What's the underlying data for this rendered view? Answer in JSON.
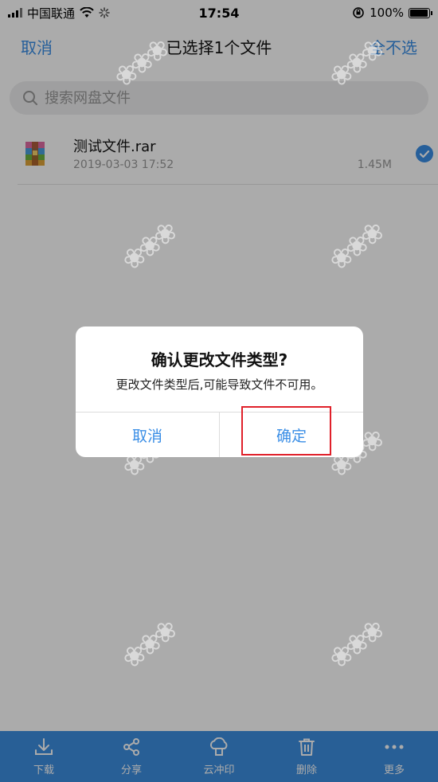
{
  "status": {
    "carrier": "中国联通",
    "time": "17:54",
    "battery": "100%",
    "battery_level": 1.0,
    "icons": [
      "signal-icon",
      "wifi-icon",
      "loading-icon",
      "orientation-lock-icon",
      "battery-icon"
    ]
  },
  "nav": {
    "cancel": "取消",
    "title": "已选择1个文件",
    "deselect_all": "全不选"
  },
  "search": {
    "placeholder": "搜索网盘文件"
  },
  "files": [
    {
      "name": "测试文件.rar",
      "date": "2019-03-03 17:52",
      "size": "1.45M",
      "selected": true,
      "icon": "rar-archive-icon"
    }
  ],
  "toolbar": {
    "items": [
      {
        "label": "下载",
        "icon": "download-icon"
      },
      {
        "label": "分享",
        "icon": "share-icon"
      },
      {
        "label": "云冲印",
        "icon": "cloud-print-icon"
      },
      {
        "label": "删除",
        "icon": "trash-icon"
      },
      {
        "label": "更多",
        "icon": "more-icon"
      }
    ]
  },
  "dialog": {
    "title": "确认更改文件类型?",
    "message": "更改文件类型后,可能导致文件不可用。",
    "cancel": "取消",
    "confirm": "确定"
  },
  "colors": {
    "accent": "#3a8ee6",
    "toolbar_bg": "#3d8ee0",
    "highlight": "#e0202a",
    "overlay": "rgba(0,0,0,0.33)"
  }
}
